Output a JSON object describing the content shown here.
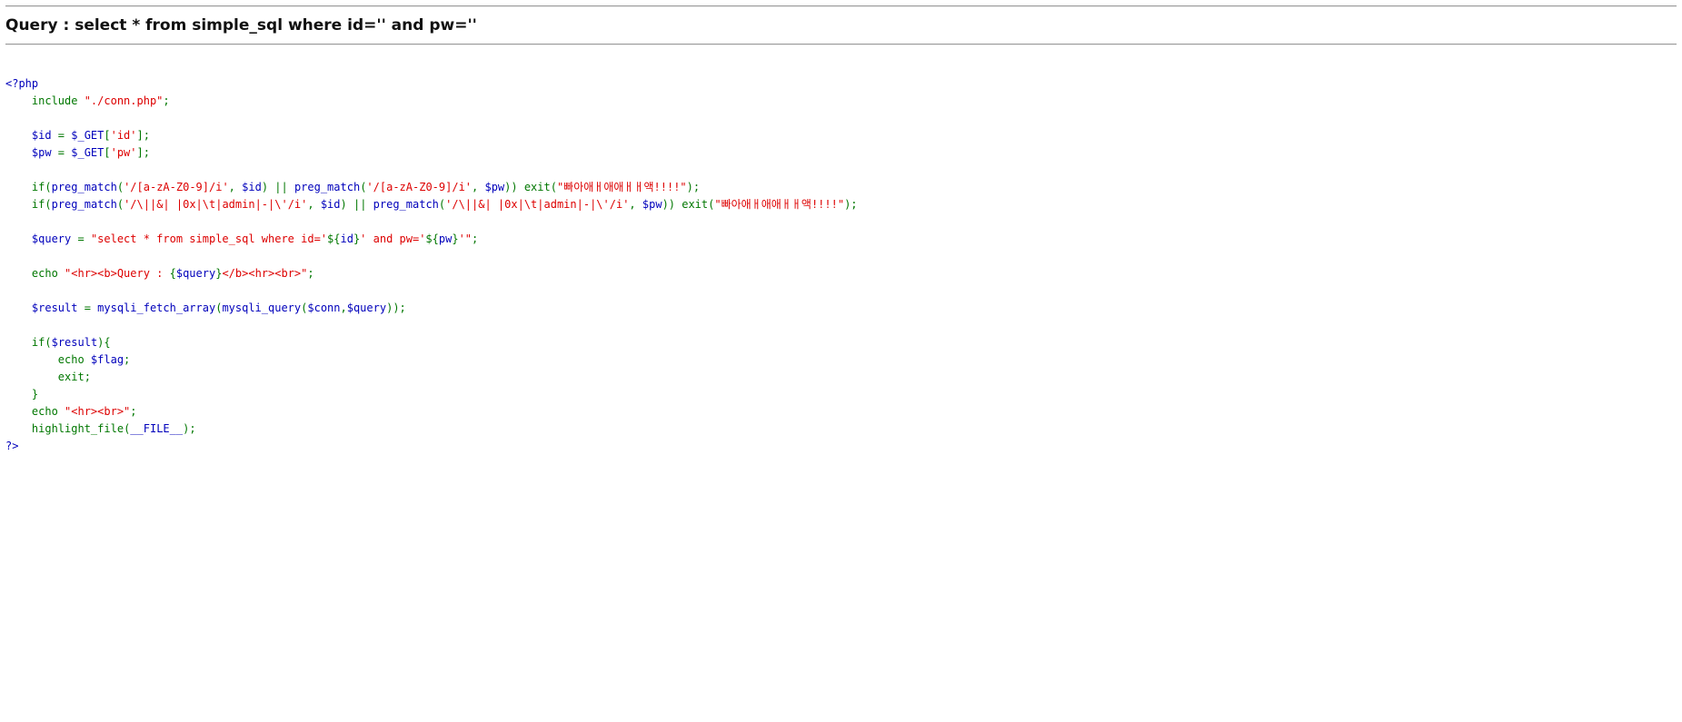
{
  "header": {
    "query_label": "Query",
    "query_sep": " : ",
    "query_text": "select * from simple_sql where id='' and pw=''"
  },
  "source": {
    "lines": [
      [
        [
          "d",
          "<?php"
        ]
      ],
      [
        [
          "d",
          "    "
        ],
        [
          "k",
          "include "
        ],
        [
          "s",
          "\"./conn.php\""
        ],
        [
          "k",
          ";"
        ]
      ],
      [],
      [
        [
          "d",
          "    $id "
        ],
        [
          "k",
          "= "
        ],
        [
          "d",
          "$_GET"
        ],
        [
          "k",
          "["
        ],
        [
          "s",
          "'id'"
        ],
        [
          "k",
          "];"
        ]
      ],
      [
        [
          "d",
          "    $pw "
        ],
        [
          "k",
          "= "
        ],
        [
          "d",
          "$_GET"
        ],
        [
          "k",
          "["
        ],
        [
          "s",
          "'pw'"
        ],
        [
          "k",
          "];"
        ]
      ],
      [],
      [
        [
          "d",
          "    "
        ],
        [
          "k",
          "if("
        ],
        [
          "d",
          "preg_match"
        ],
        [
          "k",
          "("
        ],
        [
          "s",
          "'/[a-zA-Z0-9]/i'"
        ],
        [
          "k",
          ", "
        ],
        [
          "d",
          "$id"
        ],
        [
          "k",
          ") || "
        ],
        [
          "d",
          "preg_match"
        ],
        [
          "k",
          "("
        ],
        [
          "s",
          "'/[a-zA-Z0-9]/i'"
        ],
        [
          "k",
          ", "
        ],
        [
          "d",
          "$pw"
        ],
        [
          "k",
          ")) exit("
        ],
        [
          "s",
          "\"빠아애ㅐ애애ㅐㅐ액!!!!\""
        ],
        [
          "k",
          ");"
        ]
      ],
      [
        [
          "d",
          "    "
        ],
        [
          "k",
          "if("
        ],
        [
          "d",
          "preg_match"
        ],
        [
          "k",
          "("
        ],
        [
          "s",
          "'/\\||&| |0x|\\t|admin|-|\\'/i'"
        ],
        [
          "k",
          ", "
        ],
        [
          "d",
          "$id"
        ],
        [
          "k",
          ") || "
        ],
        [
          "d",
          "preg_match"
        ],
        [
          "k",
          "("
        ],
        [
          "s",
          "'/\\||&| |0x|\\t|admin|-|\\'/i'"
        ],
        [
          "k",
          ", "
        ],
        [
          "d",
          "$pw"
        ],
        [
          "k",
          ")) exit("
        ],
        [
          "s",
          "\"빠아애ㅐ애애ㅐㅐ액!!!!\""
        ],
        [
          "k",
          ");"
        ]
      ],
      [],
      [
        [
          "d",
          "    $query "
        ],
        [
          "k",
          "= "
        ],
        [
          "s",
          "\"select * from simple_sql where id='"
        ],
        [
          "k",
          "${"
        ],
        [
          "d",
          "id"
        ],
        [
          "k",
          "}"
        ],
        [
          "s",
          "' and pw='"
        ],
        [
          "k",
          "${"
        ],
        [
          "d",
          "pw"
        ],
        [
          "k",
          "}"
        ],
        [
          "s",
          "'\""
        ],
        [
          "k",
          ";"
        ]
      ],
      [],
      [
        [
          "d",
          "    "
        ],
        [
          "k",
          "echo "
        ],
        [
          "s",
          "\"<hr><b>Query : "
        ],
        [
          "k",
          "{"
        ],
        [
          "d",
          "$query"
        ],
        [
          "k",
          "}"
        ],
        [
          "s",
          "</b><hr><br>\""
        ],
        [
          "k",
          ";"
        ]
      ],
      [],
      [
        [
          "d",
          "    $result "
        ],
        [
          "k",
          "= "
        ],
        [
          "d",
          "mysqli_fetch_array"
        ],
        [
          "k",
          "("
        ],
        [
          "d",
          "mysqli_query"
        ],
        [
          "k",
          "("
        ],
        [
          "d",
          "$conn"
        ],
        [
          "k",
          ","
        ],
        [
          "d",
          "$query"
        ],
        [
          "k",
          "));"
        ]
      ],
      [],
      [
        [
          "d",
          "    "
        ],
        [
          "k",
          "if("
        ],
        [
          "d",
          "$result"
        ],
        [
          "k",
          "){"
        ]
      ],
      [
        [
          "d",
          "        "
        ],
        [
          "k",
          "echo "
        ],
        [
          "d",
          "$flag"
        ],
        [
          "k",
          ";"
        ]
      ],
      [
        [
          "d",
          "        "
        ],
        [
          "k",
          "exit;"
        ]
      ],
      [
        [
          "d",
          "    "
        ],
        [
          "k",
          "}"
        ]
      ],
      [
        [
          "d",
          "    "
        ],
        [
          "k",
          "echo "
        ],
        [
          "s",
          "\"<hr><br>\""
        ],
        [
          "k",
          ";"
        ]
      ],
      [
        [
          "d",
          "    "
        ],
        [
          "k",
          "highlight_file"
        ],
        [
          "k",
          "("
        ],
        [
          "d",
          "__FILE__"
        ],
        [
          "k",
          ");"
        ]
      ],
      [
        [
          "d",
          "?>"
        ]
      ]
    ]
  },
  "colors": {
    "keyword": "#007700",
    "default": "#0000bb",
    "string": "#dd0000"
  }
}
